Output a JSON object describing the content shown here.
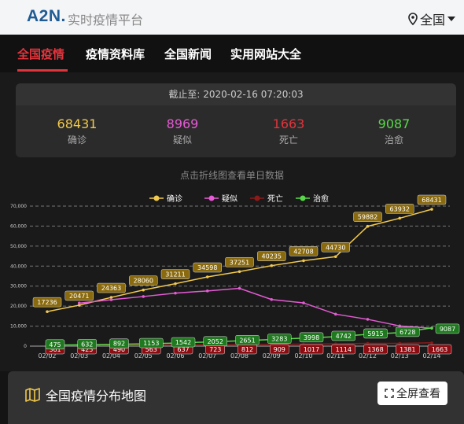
{
  "header": {
    "logo": "A2N",
    "title": "实时疫情平台",
    "region": "全国"
  },
  "tabs": [
    {
      "label": "全国疫情",
      "active": true
    },
    {
      "label": "疫情资料库"
    },
    {
      "label": "全国新闻"
    },
    {
      "label": "实用网站大全"
    }
  ],
  "stats": {
    "updated": "截止至:  2020-02-16 07:20:03",
    "items": [
      {
        "value": "68431",
        "label": "确诊",
        "color": "#f2c94c"
      },
      {
        "value": "8969",
        "label": "疑似",
        "color": "#e45bd4"
      },
      {
        "value": "1663",
        "label": "死亡",
        "color": "#e0353d"
      },
      {
        "value": "9087",
        "label": "治愈",
        "color": "#58d948"
      }
    ]
  },
  "chart_hint": "点击折线图查看单日数据",
  "chart_data": {
    "type": "line",
    "categories": [
      "02/02",
      "02/03",
      "02/04",
      "02/05",
      "02/06",
      "02/07",
      "02/08",
      "02/09",
      "02/10",
      "02/11",
      "02/12",
      "02/13",
      "02/14"
    ],
    "ylim": [
      0,
      70000
    ],
    "yticks": [
      "0",
      "10,000",
      "20,000",
      "30,000",
      "40,000",
      "50,000",
      "60,000",
      "70,000"
    ],
    "legend_position": "top-center",
    "series": [
      {
        "name": "确诊",
        "color": "#f2c94c",
        "label_bg": "#8a6a0f",
        "values": [
          17236,
          20471,
          24363,
          28060,
          31211,
          34598,
          37251,
          40235,
          42708,
          44730,
          59882,
          63932,
          68431
        ],
        "labels": [
          "17236",
          "20471",
          "24363",
          "28060",
          "31211",
          "34598",
          "37251",
          "40235",
          "42708",
          "44730",
          "59882",
          "63932",
          "68431"
        ]
      },
      {
        "name": "疑似",
        "color": "#e45bd4",
        "label_bg": "#8a2a80",
        "values": [
          null,
          21500,
          23200,
          24800,
          26500,
          27600,
          28900,
          23300,
          21600,
          16000,
          13400,
          10100,
          8969
        ],
        "labels": []
      },
      {
        "name": "死亡",
        "color": "#8b1a1a",
        "label_bg": "#8b0d12",
        "values": [
          361,
          425,
          490,
          563,
          637,
          723,
          812,
          909,
          1017,
          1114,
          1368,
          1381,
          1663
        ],
        "labels": [
          "361",
          "425",
          "490",
          "563",
          "637",
          "723",
          "812",
          "909",
          "1017",
          "1114",
          "1368",
          "1381",
          "1663"
        ]
      },
      {
        "name": "治愈",
        "color": "#58d948",
        "label_bg": "#1f7a1f",
        "values": [
          475,
          632,
          892,
          1153,
          1542,
          2052,
          2651,
          3283,
          3998,
          4742,
          5915,
          6728,
          9087
        ],
        "labels": [
          "475",
          "632",
          "892",
          "1153",
          "1542",
          "2052",
          "2651",
          "3283",
          "3998",
          "4742",
          "5915",
          "6728",
          "9087"
        ]
      }
    ]
  },
  "map": {
    "title": "全国疫情分布地图",
    "fullscreen": "全屏查看"
  }
}
